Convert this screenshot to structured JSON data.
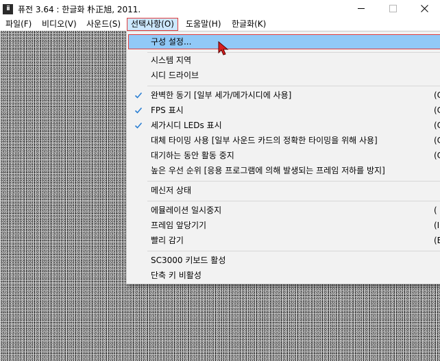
{
  "window": {
    "title": "퓨전 3.64 : 한글화 朴正旭, 2011.",
    "icon_label": "ii"
  },
  "menubar": [
    {
      "label": "파일(F)",
      "open": false
    },
    {
      "label": "비디오(V)",
      "open": false
    },
    {
      "label": "사운드(S)",
      "open": false
    },
    {
      "label": "선택사항(O)",
      "open": true
    },
    {
      "label": "도움말(H)",
      "open": false
    },
    {
      "label": "한글화(K)",
      "open": false
    }
  ],
  "dropdown": {
    "items": [
      {
        "label": "구성 설정...",
        "shortcut": "",
        "checked": false,
        "highlighted": true
      },
      {
        "label": "시스템 지역",
        "shortcut": "",
        "checked": false
      },
      {
        "label": "시디 드라이브",
        "shortcut": "",
        "checked": false
      },
      {
        "label": "완벽한 동기 [일부 세가/메가시디에 사용]",
        "shortcut": "(C",
        "checked": true
      },
      {
        "label": "FPS 표시",
        "shortcut": "(C",
        "checked": true
      },
      {
        "label": "세가시디 LEDs 표시",
        "shortcut": "(C",
        "checked": true
      },
      {
        "label": "대체 타이밍 사용 [일부 사운드 카드의 정확한 타이밍을 위해 사용]",
        "shortcut": "(C",
        "checked": false
      },
      {
        "label": "대기하는 동안 활동 중지",
        "shortcut": "(C",
        "checked": false
      },
      {
        "label": "높은 우선 순위 [응용 프로그램에 의해 발생되는 프레임 저하를 방지]",
        "shortcut": "",
        "checked": false
      },
      {
        "label": "메신저 상태",
        "shortcut": "",
        "checked": false
      },
      {
        "label": "에뮬레이션 일시중지",
        "shortcut": "(",
        "checked": false
      },
      {
        "label": "프레임 앞당기기",
        "shortcut": "(I",
        "checked": false
      },
      {
        "label": "빨리 감기",
        "shortcut": "(BAC",
        "checked": false
      },
      {
        "label": "SC3000 키보드 활성",
        "shortcut": "",
        "checked": false
      },
      {
        "label": "단축 키 비활성",
        "shortcut": "",
        "checked": false
      }
    ]
  },
  "colors": {
    "highlight": "#91c9f7",
    "focus_border": "#e03b3b",
    "check": "#2a7fd4"
  }
}
